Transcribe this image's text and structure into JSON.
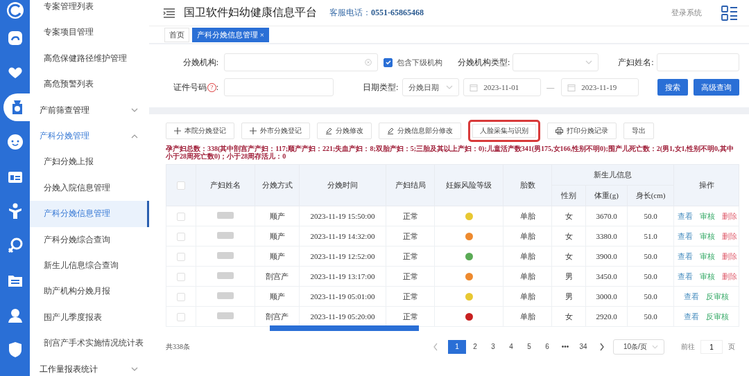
{
  "rail": [
    {
      "selected": false
    },
    {
      "selected": false
    },
    {
      "selected": false
    },
    {
      "selected": true
    },
    {
      "selected": false
    },
    {
      "selected": false
    },
    {
      "selected": false
    },
    {
      "selected": false
    },
    {
      "selected": false
    },
    {
      "selected": false
    },
    {
      "selected": false
    }
  ],
  "sidebar": {
    "items": [
      {
        "kind": "item",
        "label": "专案管理列表",
        "selected": false
      },
      {
        "kind": "item",
        "label": "专案项目管理",
        "selected": false
      },
      {
        "kind": "item",
        "label": "高危保健路径维护管理",
        "selected": false
      },
      {
        "kind": "item",
        "label": "高危预警列表",
        "selected": false
      },
      {
        "kind": "group",
        "label": "产前筛查管理",
        "expanded": false,
        "selected": false
      },
      {
        "kind": "group",
        "label": "产科分娩管理",
        "expanded": true,
        "selected": true,
        "children": [
          {
            "kind": "item",
            "label": "产妇分娩上报",
            "selected": false
          },
          {
            "kind": "item",
            "label": "分娩入院信息管理",
            "selected": false
          },
          {
            "kind": "item",
            "label": "产科分娩信息管理",
            "selected": true
          },
          {
            "kind": "item",
            "label": "产科分娩综合查询",
            "selected": false
          },
          {
            "kind": "item",
            "label": "新生儿信息综合查询",
            "selected": false
          },
          {
            "kind": "item",
            "label": "助产机构分娩月报",
            "selected": false
          },
          {
            "kind": "item",
            "label": "围产儿季度报表",
            "selected": false
          },
          {
            "kind": "item",
            "label": "剖宫产手术实施情况统计表",
            "selected": false
          }
        ]
      },
      {
        "kind": "group",
        "label": "工作量报表统计",
        "expanded": false,
        "selected": false
      }
    ]
  },
  "header": {
    "title": "国卫软件妇幼健康信息平台",
    "hotline_label": "客服电话：",
    "hotline": "0551-65865468",
    "login": "登录系统"
  },
  "tabs": [
    {
      "label": "首页",
      "selected": false
    },
    {
      "label": "产科分娩信息管理",
      "selected": true,
      "close": "×"
    }
  ],
  "filters": {
    "org_label": "分娩机构:",
    "include_sub": {
      "label": "包含下级机构",
      "checked": true
    },
    "org_type_label": "分娩机构类型:",
    "mother_name_label": "产妇姓名:",
    "id_label": "证件号码",
    "help_mark": "?",
    "id_colon": ":",
    "date_type_label": "日期类型:",
    "date_type": "分娩日期",
    "date_from": "2023-11-01",
    "date_sep": "—",
    "date_to": "2023-11-19",
    "buttons": [
      "搜索",
      "高级查询"
    ]
  },
  "toolbar": [
    {
      "kind": "add",
      "label": "本院分娩登记",
      "highlighted": false
    },
    {
      "kind": "add",
      "label": "外市分娩登记",
      "highlighted": false
    },
    {
      "kind": "edit",
      "label": "分娩修改",
      "highlighted": false
    },
    {
      "kind": "edit",
      "label": "分娩信息部分修改",
      "highlighted": false
    },
    {
      "kind": "plain",
      "label": "人脸采集与识别",
      "highlighted": true
    },
    {
      "kind": "print",
      "label": "打印分娩记录",
      "highlighted": false
    },
    {
      "kind": "plain",
      "label": "导出",
      "highlighted": false
    }
  ],
  "summary": "孕产妇总数：338(其中剖宫产产妇：117;顺产产妇：221;失血产妇：8;双胎产妇：5;三胎及其以上产妇：0);儿童活产数341(男175,女166,性别不明0);围产儿死亡数：2(男1,女1,性别不明0,其中小于28周死亡数0)；小于28周存活儿：0",
  "table": {
    "select_all": {
      "checked": false
    },
    "columns": [
      "产妇姓名",
      "分娩方式",
      "分娩时间",
      "产妇结局",
      "妊娠风险等级",
      "胎数"
    ],
    "group_header": "新生儿信息",
    "sub_columns": [
      "性别",
      "体重(g)",
      "身长(cm)"
    ],
    "actions_header": "操作",
    "rows": [
      {
        "checked": false,
        "method": "顺产",
        "time": "2023-11-19 15:50:00",
        "outcome": "正常",
        "color": "#e8c832",
        "count": "单胎",
        "sex": "女",
        "weight": "3670.0",
        "length": "50.0",
        "actions": [
          {
            "kind": "view",
            "label": "查看"
          },
          {
            "kind": "audit",
            "label": "审核"
          },
          {
            "kind": "delete",
            "label": "删除"
          }
        ]
      },
      {
        "checked": false,
        "method": "顺产",
        "time": "2023-11-19 14:32:00",
        "outcome": "正常",
        "color": "#ee8a2e",
        "count": "单胎",
        "sex": "女",
        "weight": "3380.0",
        "length": "51.0",
        "actions": [
          {
            "kind": "view",
            "label": "查看"
          },
          {
            "kind": "audit",
            "label": "审核"
          },
          {
            "kind": "delete",
            "label": "删除"
          }
        ]
      },
      {
        "checked": false,
        "method": "顺产",
        "time": "2023-11-19 12:52:00",
        "outcome": "正常",
        "color": "#5aaa55",
        "count": "单胎",
        "sex": "女",
        "weight": "3900.0",
        "length": "50.0",
        "actions": [
          {
            "kind": "view",
            "label": "查看"
          },
          {
            "kind": "audit",
            "label": "审核"
          },
          {
            "kind": "delete",
            "label": "删除"
          }
        ]
      },
      {
        "checked": false,
        "method": "剖宫产",
        "time": "2023-11-19 13:17:00",
        "outcome": "正常",
        "color": "#ee8a2e",
        "count": "单胎",
        "sex": "男",
        "weight": "3450.0",
        "length": "50.0",
        "actions": [
          {
            "kind": "view",
            "label": "查看"
          },
          {
            "kind": "audit",
            "label": "审核"
          },
          {
            "kind": "delete",
            "label": "删除"
          }
        ]
      },
      {
        "checked": false,
        "method": "顺产",
        "time": "2023-11-19 05:01:00",
        "outcome": "正常",
        "color": "#e8c832",
        "count": "单胎",
        "sex": "男",
        "weight": "3000.0",
        "length": "50.0",
        "actions": [
          {
            "kind": "view",
            "label": "查看"
          },
          {
            "kind": "audit",
            "label": "反审核"
          }
        ]
      },
      {
        "checked": false,
        "method": "剖宫产",
        "time": "2023-11-19 05:20:00",
        "outcome": "正常",
        "color": "#c82020",
        "count": "单胎",
        "sex": "女",
        "weight": "2920.0",
        "length": "50.0",
        "actions": [
          {
            "kind": "view",
            "label": "查看"
          },
          {
            "kind": "audit",
            "label": "反审核"
          }
        ]
      }
    ]
  },
  "pagination": {
    "total": "共338条",
    "pages": [
      {
        "label": "1",
        "selected": true
      },
      {
        "label": "2",
        "selected": false
      },
      {
        "label": "3",
        "selected": false
      },
      {
        "label": "4",
        "selected": false
      },
      {
        "label": "5",
        "selected": false
      },
      {
        "label": "6",
        "selected": false
      },
      {
        "label": "•••",
        "selected": false
      },
      {
        "label": "34",
        "selected": false
      }
    ],
    "page_size": "10条/页",
    "goto_label": "前往",
    "goto_value": "1",
    "goto_suffix": "页"
  }
}
